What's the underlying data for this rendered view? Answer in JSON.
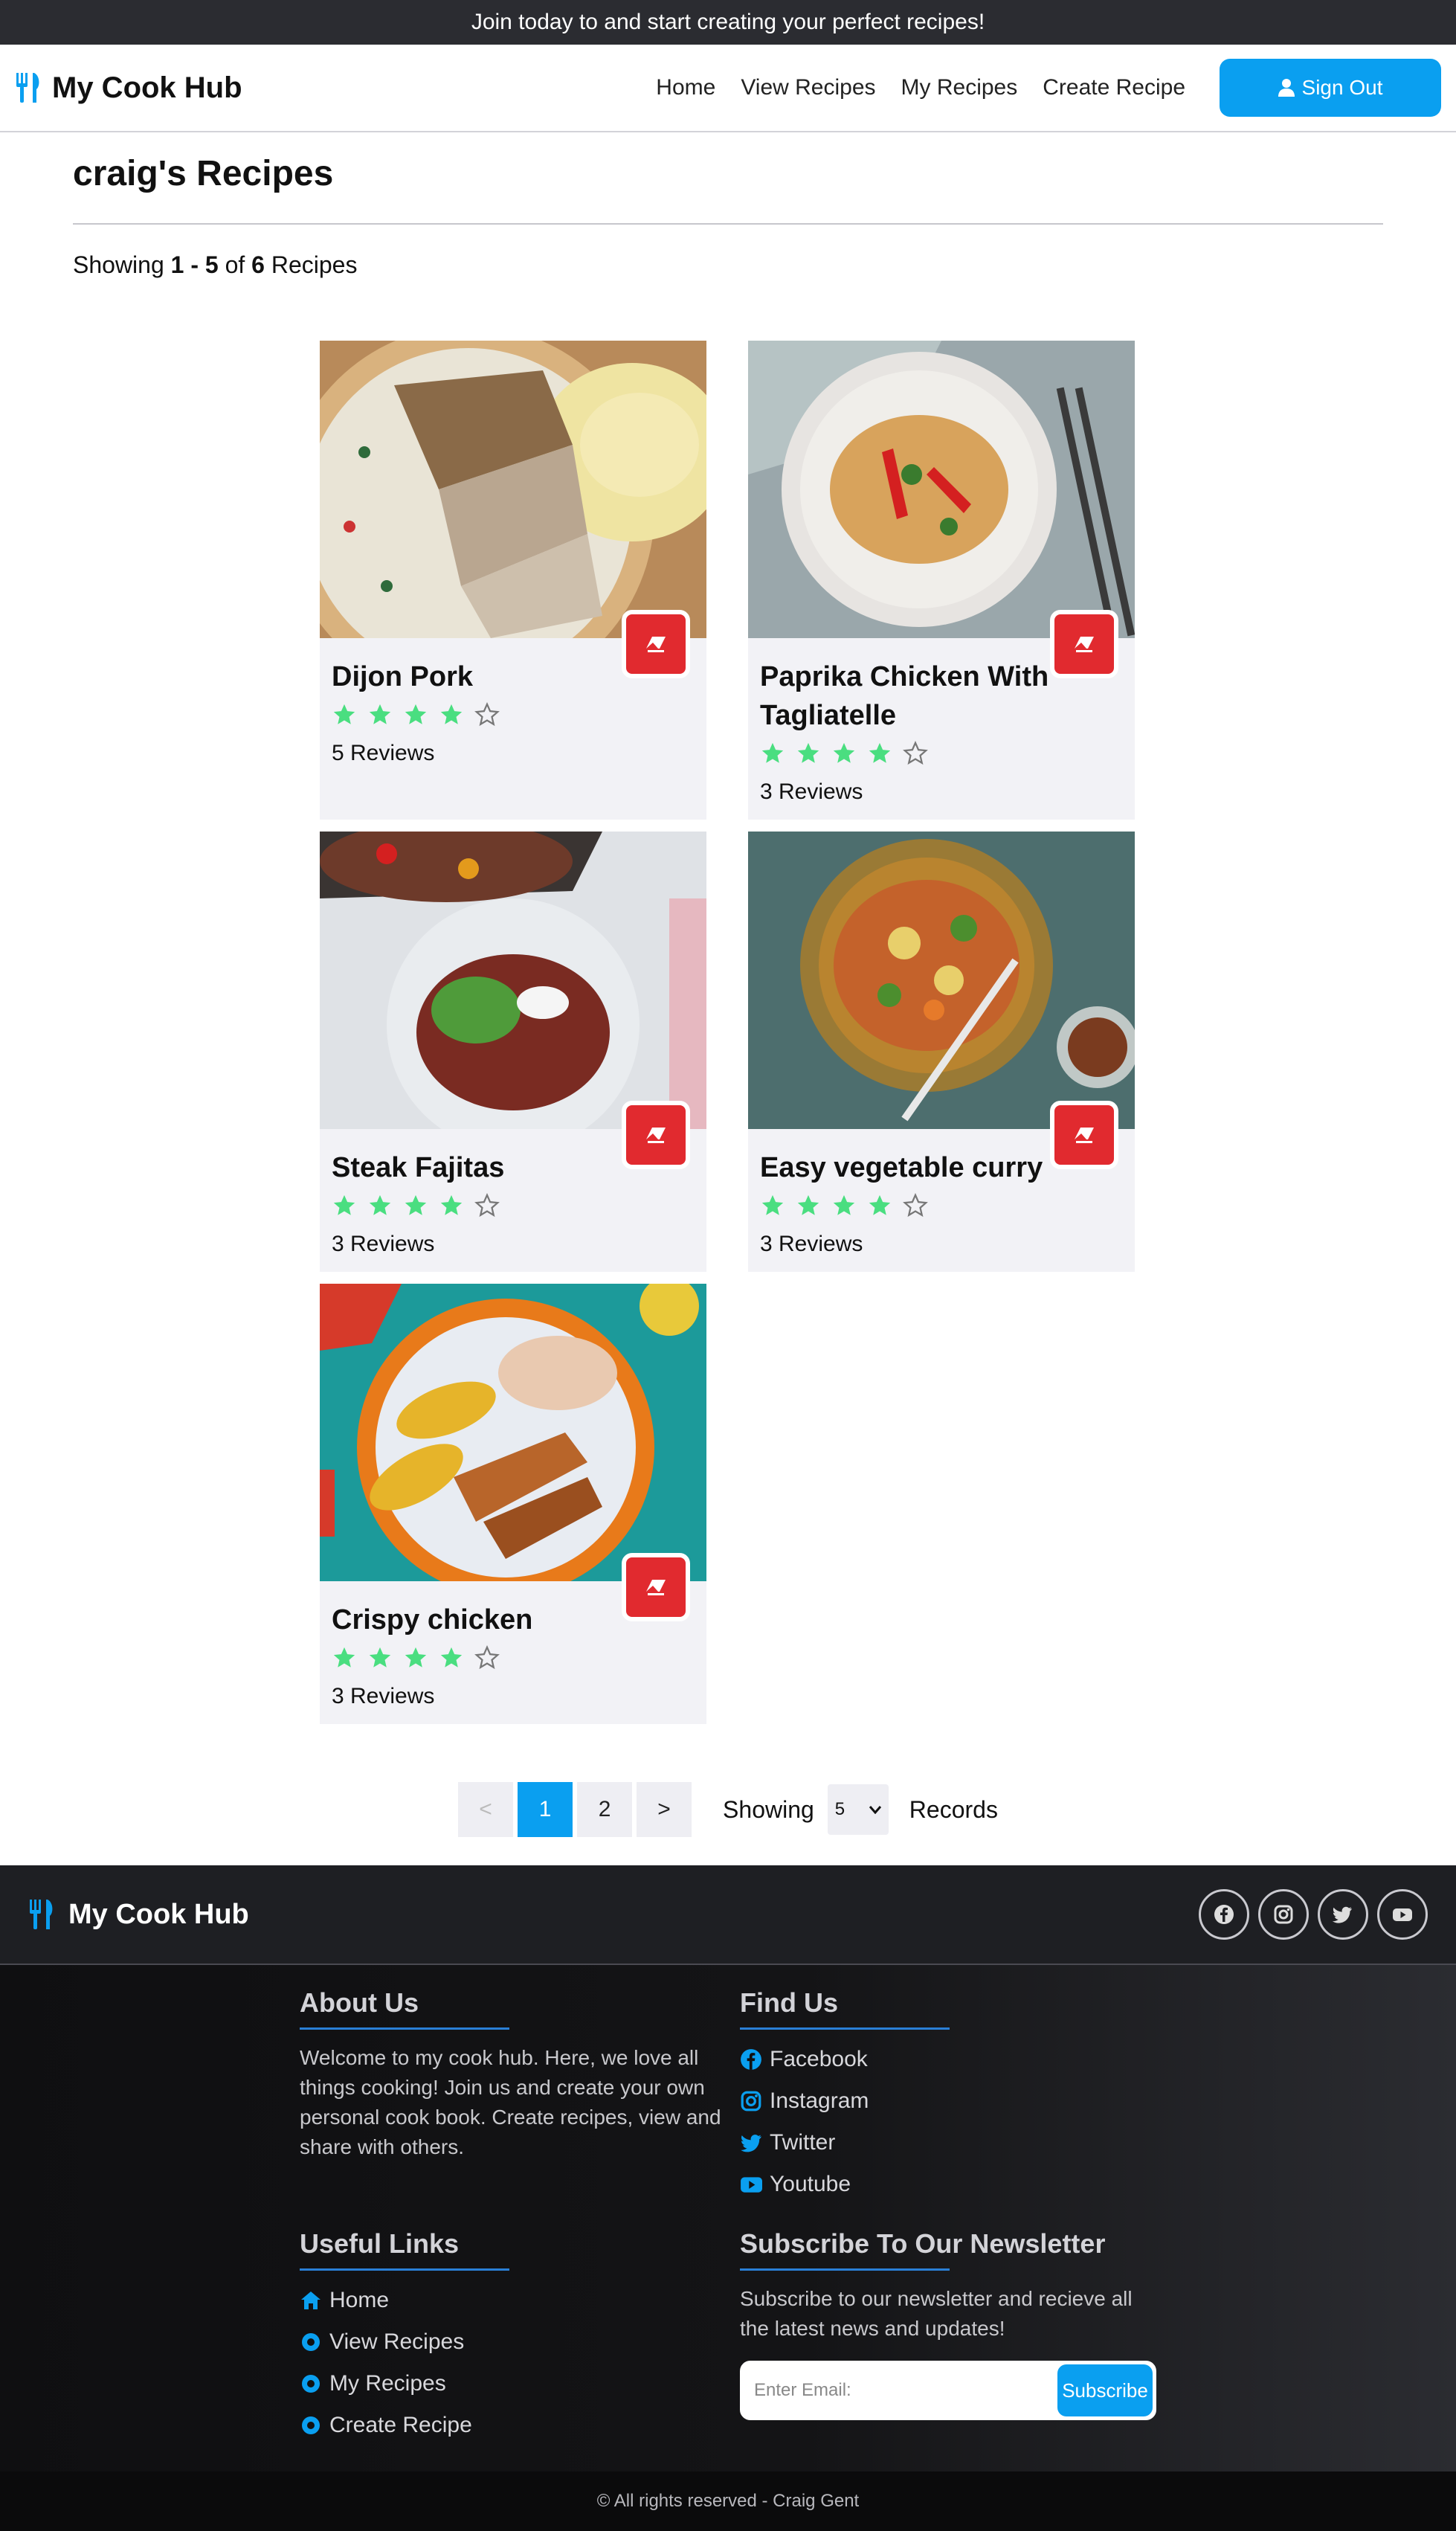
{
  "banner": {
    "text": "Join today to and start creating your perfect recipes!"
  },
  "nav": {
    "brand": "My Cook Hub",
    "links": [
      "Home",
      "View Recipes",
      "My Recipes",
      "Create Recipe"
    ],
    "signout_label": "Sign Out"
  },
  "page": {
    "title": "craig's Recipes",
    "showing_prefix": "Showing",
    "range_start": "1",
    "range_sep": "-",
    "range_end": "5",
    "of_label": "of",
    "total": "6",
    "suffix": "Recipes"
  },
  "recipes": [
    {
      "title": "Dijon Pork",
      "rating": 4,
      "reviews": "5 Reviews"
    },
    {
      "title": "Paprika Chicken With Tagliatelle",
      "rating": 4,
      "reviews": "3 Reviews"
    },
    {
      "title": "Steak Fajitas",
      "rating": 4,
      "reviews": "3 Reviews"
    },
    {
      "title": "Easy vegetable curry",
      "rating": 4,
      "reviews": "3 Reviews"
    },
    {
      "title": "Crispy chicken",
      "rating": 4,
      "reviews": "3 Reviews"
    }
  ],
  "pagination": {
    "prev": "<",
    "pages": [
      "1",
      "2"
    ],
    "active": "1",
    "next": ">",
    "showing_label": "Showing",
    "per_page": "5",
    "records_label": "Records"
  },
  "footer": {
    "brand": "My Cook Hub",
    "socials": [
      "facebook-icon",
      "instagram-icon",
      "twitter-icon",
      "youtube-icon"
    ],
    "about": {
      "heading": "About Us",
      "text": "Welcome to my cook hub. Here, we love all things cooking! Join us and create your own personal cook book. Create recipes, view and share with others."
    },
    "find": {
      "heading": "Find Us",
      "links": [
        "Facebook",
        "Instagram",
        "Twitter",
        "Youtube"
      ]
    },
    "useful": {
      "heading": "Useful Links",
      "links": [
        "Home",
        "View Recipes",
        "My Recipes",
        "Create Recipe"
      ]
    },
    "newsletter": {
      "heading": "Subscribe To Our Newsletter",
      "text": "Subscribe to our newsletter and recieve all the latest news and updates!",
      "placeholder": "Enter Email:",
      "button": "Subscribe"
    },
    "copyright": "© All rights reserved - Craig Gent"
  },
  "colors": {
    "accent": "#0a9ff0",
    "danger": "#e12a2f",
    "star": "#4ade80"
  }
}
